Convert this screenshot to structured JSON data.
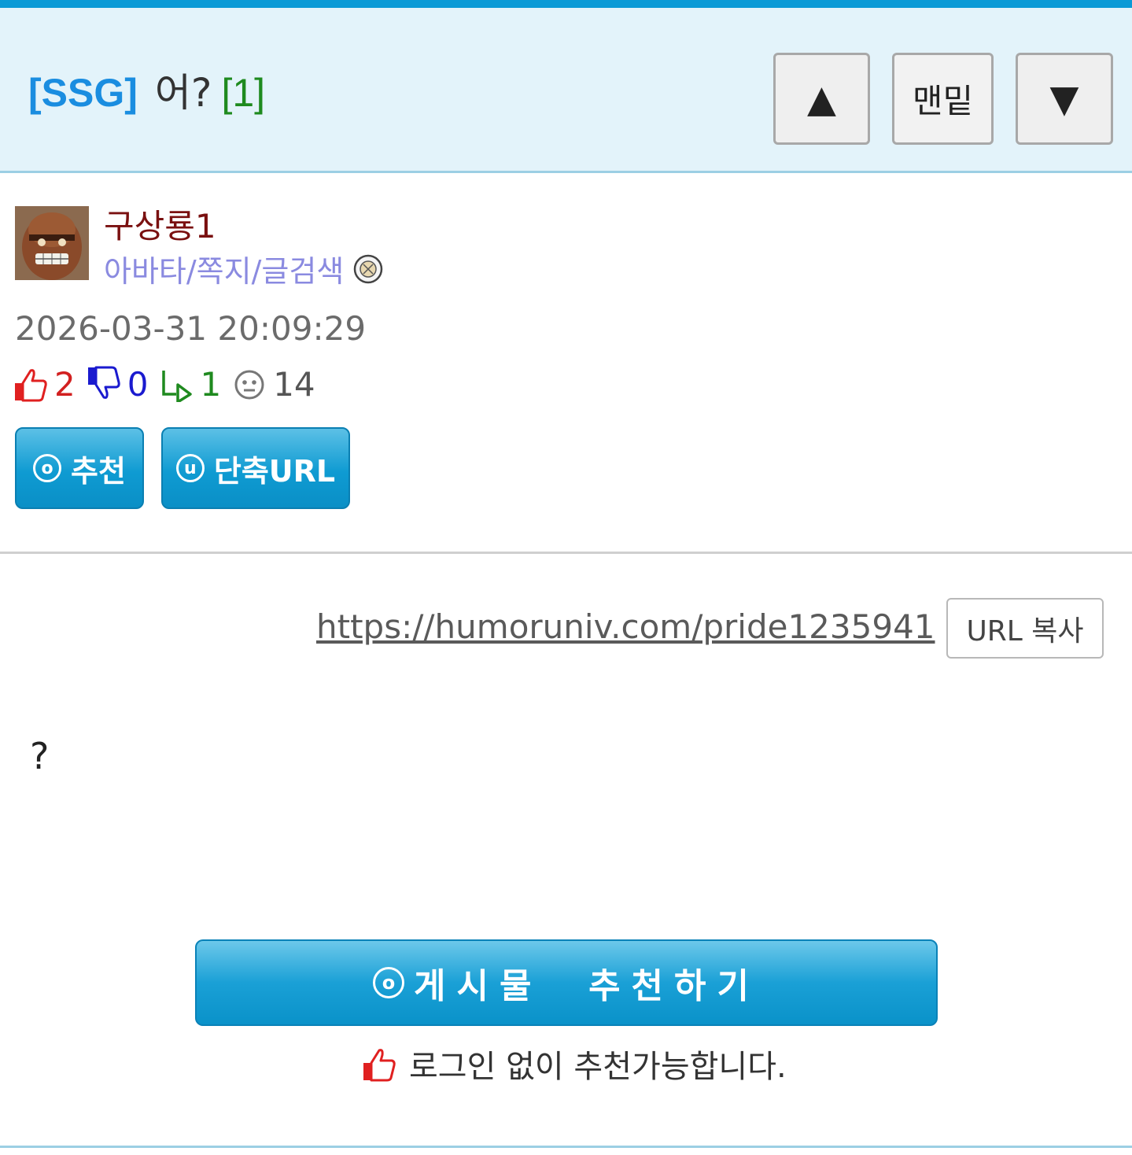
{
  "header": {
    "tag": "[SSG]",
    "title": "어?",
    "comment_count": "[1]",
    "up_button_glyph": "▲",
    "bottom_button_label": "맨밑",
    "down_button_glyph": "▼"
  },
  "author": {
    "avatar_icon": "avatar-character",
    "name": "구상룡1",
    "links_label": "아바타/쪽지/글검색",
    "badge_icon": "level-badge-icon"
  },
  "post": {
    "date": "2026-03-31 20:09:29",
    "stats": {
      "up": "2",
      "down": "0",
      "replies": "1",
      "views": "14"
    },
    "actions": {
      "recommend_icon_letter": "o",
      "recommend_label": "추천",
      "shorturl_icon_letter": "u",
      "shorturl_label": "단축URL"
    },
    "url": "https://humoruniv.com/pride1235941",
    "url_copy_label": "URL 복사",
    "body": "?"
  },
  "footer": {
    "recommend_icon_letter": "o",
    "recommend_big_label": "게시물  추천하기",
    "login_note": "로그인 없이 추천가능합니다."
  },
  "colors": {
    "accent": "#0b9ad6",
    "header_bg": "#e3f3fa",
    "tag": "#1a8de0",
    "count": "#1e8a1e",
    "author": "#7a1010",
    "links": "#8a8ae0",
    "up": "#d22020",
    "down": "#1a1acf",
    "reply": "#1f8a1f"
  }
}
